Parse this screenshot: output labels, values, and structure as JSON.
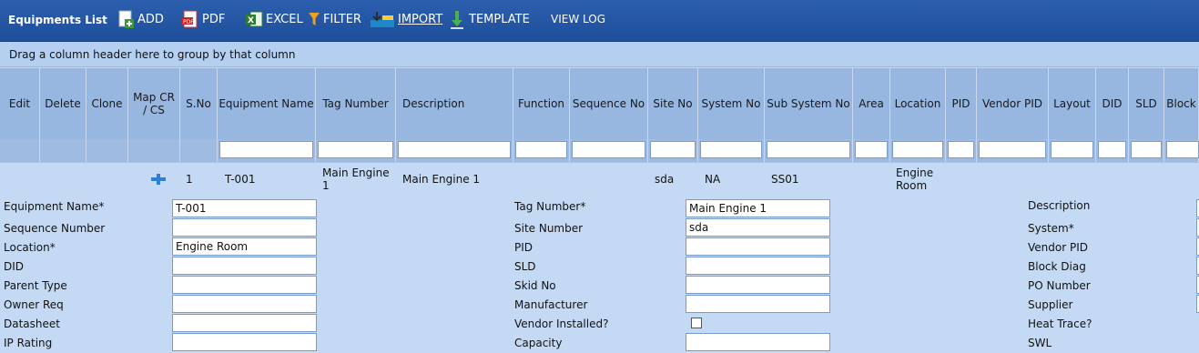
{
  "toolbar": {
    "title": "Equipments List",
    "add": "ADD",
    "pdf": "PDF",
    "excel": "EXCEL",
    "filter": "FILTER",
    "import": "IMPORT",
    "template": "TEMPLATE",
    "view_log": "VIEW LOG"
  },
  "group_hint": "Drag a column header here to group by that column",
  "columns": [
    "Edit",
    "Delete",
    "Clone",
    "Map CR / CS",
    "S.No",
    "Equipment Name",
    "Tag Number",
    "Description",
    "Function",
    "Sequence No",
    "Site No",
    "System No",
    "Sub System No",
    "Area",
    "Location",
    "PID",
    "Vendor PID",
    "Layout",
    "DID",
    "SLD",
    "Block"
  ],
  "row": {
    "sno": "1",
    "equipment_name": "T-001",
    "tag_number": "Main Engine 1",
    "description": "Main Engine 1",
    "site_no": "sda",
    "system_no": "NA",
    "sub_system_no": "SS01",
    "location": "Engine Room"
  },
  "form": {
    "col1": [
      {
        "label": "Equipment Name*",
        "value": "T-001"
      },
      {
        "label": "Sequence Number",
        "value": ""
      },
      {
        "label": "Location*",
        "value": "Engine Room"
      },
      {
        "label": "DID",
        "value": ""
      },
      {
        "label": "Parent Type",
        "value": ""
      },
      {
        "label": "Owner Req",
        "value": ""
      },
      {
        "label": "Datasheet",
        "value": ""
      },
      {
        "label": "IP Rating",
        "value": ""
      }
    ],
    "col2": [
      {
        "label": "Tag Number*",
        "value": "Main Engine 1"
      },
      {
        "label": "Site Number",
        "value": "sda"
      },
      {
        "label": "PID",
        "value": ""
      },
      {
        "label": "SLD",
        "value": ""
      },
      {
        "label": "Skid No",
        "value": ""
      },
      {
        "label": "Manufacturer",
        "value": ""
      },
      {
        "label": "Vendor Installed?",
        "value": ""
      },
      {
        "label": "Capacity",
        "value": ""
      }
    ],
    "col3": [
      "Description",
      "System*",
      "Vendor PID",
      "Block Diag",
      "PO Number",
      "Supplier",
      "Heat Trace?",
      "SWL"
    ]
  },
  "colors": {
    "toolbar": "#1f4e9a",
    "header": "#97b6e0",
    "body": "#c4daf4"
  }
}
